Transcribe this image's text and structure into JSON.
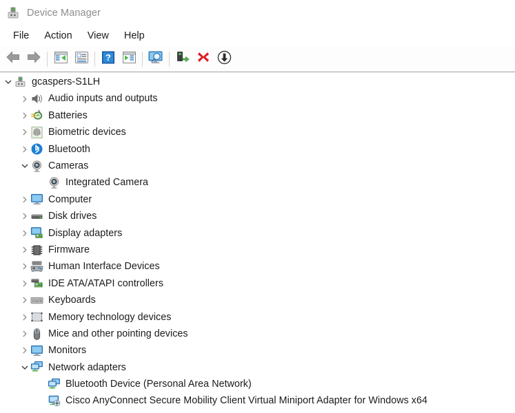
{
  "window": {
    "title": "Device Manager",
    "icon": "device-manager-icon"
  },
  "menubar": {
    "items": [
      {
        "label": "File",
        "name": "menu-file"
      },
      {
        "label": "Action",
        "name": "menu-action"
      },
      {
        "label": "View",
        "name": "menu-view"
      },
      {
        "label": "Help",
        "name": "menu-help"
      }
    ]
  },
  "toolbar": {
    "buttons": [
      {
        "name": "back-button",
        "icon": "back-arrow-icon",
        "label": "Back"
      },
      {
        "name": "forward-button",
        "icon": "forward-arrow-icon",
        "label": "Forward"
      },
      {
        "name": "separator-1",
        "icon": "separator",
        "label": ""
      },
      {
        "name": "show-console-tree-button",
        "icon": "console-tree-icon",
        "label": "Show/Hide Console Tree"
      },
      {
        "name": "properties-button",
        "icon": "properties-icon",
        "label": "Properties"
      },
      {
        "name": "separator-2",
        "icon": "separator",
        "label": ""
      },
      {
        "name": "help-button",
        "icon": "help-question-icon",
        "label": "Help"
      },
      {
        "name": "show-hidden-devices-button",
        "icon": "play-panel-icon",
        "label": "Show hidden devices"
      },
      {
        "name": "separator-3",
        "icon": "separator",
        "label": ""
      },
      {
        "name": "scan-hardware-changes-button",
        "icon": "scan-monitor-icon",
        "label": "Scan for hardware changes"
      },
      {
        "name": "separator-4",
        "icon": "separator",
        "label": ""
      },
      {
        "name": "update-driver-button",
        "icon": "update-driver-icon",
        "label": "Update driver"
      },
      {
        "name": "uninstall-device-button",
        "icon": "red-x-icon",
        "label": "Uninstall device"
      },
      {
        "name": "disable-device-button",
        "icon": "down-arrow-circle-icon",
        "label": "Disable device"
      }
    ]
  },
  "tree": {
    "rows": [
      {
        "label": "gcaspers-S1LH",
        "depth": 0,
        "state": "expanded",
        "icon": "computer-node-icon",
        "name": "tree-item-gcaspers-s1lh"
      },
      {
        "label": "Audio inputs and outputs",
        "depth": 1,
        "state": "collapsed",
        "icon": "speaker-icon",
        "name": "tree-item-audio-inputs-and-outputs"
      },
      {
        "label": "Batteries",
        "depth": 1,
        "state": "collapsed",
        "icon": "battery-icon",
        "name": "tree-item-batteries"
      },
      {
        "label": "Biometric devices",
        "depth": 1,
        "state": "collapsed",
        "icon": "fingerprint-icon",
        "name": "tree-item-biometric-devices"
      },
      {
        "label": "Bluetooth",
        "depth": 1,
        "state": "collapsed",
        "icon": "bluetooth-icon",
        "name": "tree-item-bluetooth"
      },
      {
        "label": "Cameras",
        "depth": 1,
        "state": "expanded",
        "icon": "camera-icon",
        "name": "tree-item-cameras"
      },
      {
        "label": "Integrated Camera",
        "depth": 2,
        "state": "leaf",
        "icon": "camera-icon",
        "name": "tree-item-integrated-camera"
      },
      {
        "label": "Computer",
        "depth": 1,
        "state": "collapsed",
        "icon": "monitor-icon",
        "name": "tree-item-computer"
      },
      {
        "label": "Disk drives",
        "depth": 1,
        "state": "collapsed",
        "icon": "disk-drive-icon",
        "name": "tree-item-disk-drives"
      },
      {
        "label": "Display adapters",
        "depth": 1,
        "state": "collapsed",
        "icon": "display-adapter-icon",
        "name": "tree-item-display-adapters"
      },
      {
        "label": "Firmware",
        "depth": 1,
        "state": "collapsed",
        "icon": "chip-icon",
        "name": "tree-item-firmware"
      },
      {
        "label": "Human Interface Devices",
        "depth": 1,
        "state": "collapsed",
        "icon": "gamepad-icon",
        "name": "tree-item-human-interface-devices"
      },
      {
        "label": "IDE ATA/ATAPI controllers",
        "depth": 1,
        "state": "collapsed",
        "icon": "ide-controller-icon",
        "name": "tree-item-ide-ata-atapi-controllers"
      },
      {
        "label": "Keyboards",
        "depth": 1,
        "state": "collapsed",
        "icon": "keyboard-icon",
        "name": "tree-item-keyboards"
      },
      {
        "label": "Memory technology devices",
        "depth": 1,
        "state": "collapsed",
        "icon": "memory-card-icon",
        "name": "tree-item-memory-technology-devices"
      },
      {
        "label": "Mice and other pointing devices",
        "depth": 1,
        "state": "collapsed",
        "icon": "mouse-icon",
        "name": "tree-item-mice-and-other-pointing-devices"
      },
      {
        "label": "Monitors",
        "depth": 1,
        "state": "collapsed",
        "icon": "monitor-icon",
        "name": "tree-item-monitors"
      },
      {
        "label": "Network adapters",
        "depth": 1,
        "state": "expanded",
        "icon": "network-adapter-icon",
        "name": "tree-item-network-adapters"
      },
      {
        "label": "Bluetooth Device (Personal Area Network)",
        "depth": 2,
        "state": "leaf",
        "icon": "network-adapter-icon",
        "name": "tree-item-bluetooth-device-personal-area-network"
      },
      {
        "label": "Cisco AnyConnect Secure Mobility Client Virtual Miniport Adapter for Windows x64",
        "depth": 2,
        "state": "leaf",
        "icon": "virtual-network-adapter-icon",
        "name": "tree-item-cisco-anyconnect-virtual-miniport-adapter"
      }
    ]
  },
  "colors": {
    "accent_blue": "#2f8ad8",
    "led_green": "#36b632",
    "uninstall_red": "#e01b24",
    "text": "#1b1b1b",
    "title_text": "#8d8d8d"
  }
}
